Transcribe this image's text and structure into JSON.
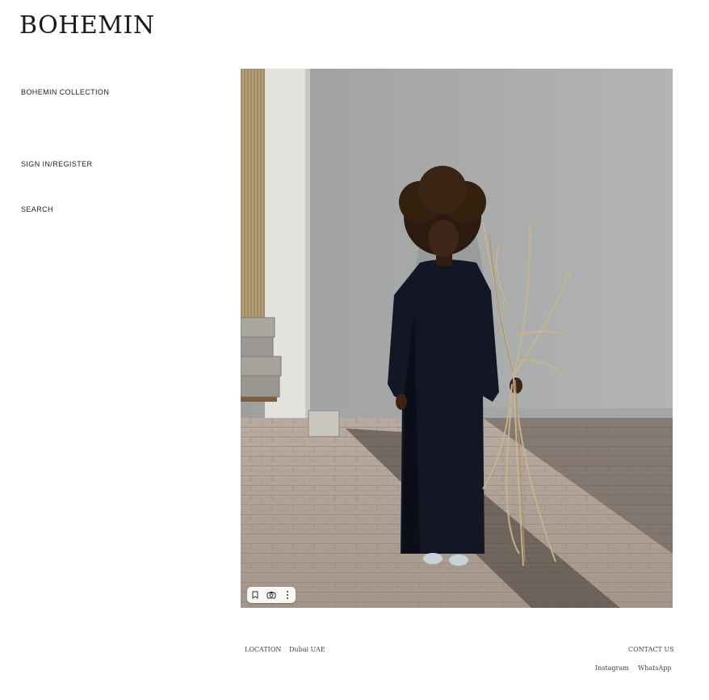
{
  "brand": {
    "logo": "BOHEMIN"
  },
  "nav": {
    "collection": "BOHEMIN COLLECTION",
    "sign_in": "SIGN IN/REGISTER",
    "search": "SEARCH"
  },
  "hero": {
    "toolbar_icons": [
      "bookmark-icon",
      "camera-icon",
      "more-icon"
    ]
  },
  "footer": {
    "location_label": "LOCATION",
    "location_value": "Dubai UAE",
    "contact_label": "CONTACT US",
    "instagram": "Instagram",
    "whatsapp": "WhatsApp"
  }
}
